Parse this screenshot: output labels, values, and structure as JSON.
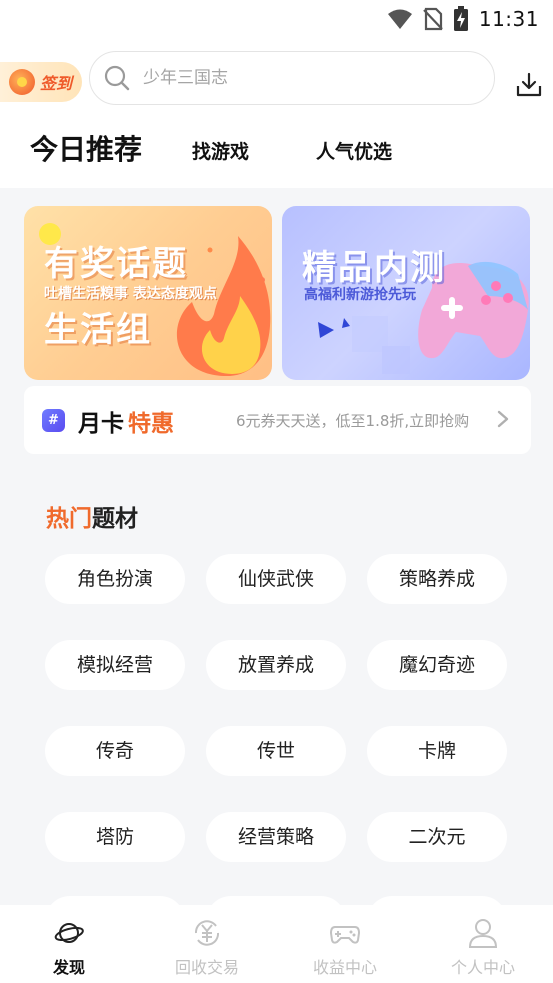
{
  "status_bar": {
    "time": "11:31"
  },
  "header": {
    "signin_label": "签到",
    "search_placeholder": "少年三国志",
    "tabs": [
      "今日推荐",
      "找游戏",
      "人气优选"
    ]
  },
  "banners": [
    {
      "title": "有奖话题",
      "subtitle": "吐槽生活糗事 表达态度观点",
      "title2": "生活组"
    },
    {
      "title": "精品内测",
      "subtitle": "高福利新游抢先玩"
    }
  ],
  "month_card": {
    "title_a": "月卡",
    "title_b": "特惠",
    "description": "6元券天天送，低至1.8折,立即抢购"
  },
  "hot_topics": {
    "title_a": "热门",
    "title_b": "题材",
    "chips": [
      "角色扮演",
      "仙侠武侠",
      "策略养成",
      "模拟经营",
      "放置养成",
      "魔幻奇迹",
      "传奇",
      "传世",
      "卡牌",
      "塔防",
      "经营策略",
      "二次元"
    ]
  },
  "bottom_nav": {
    "items": [
      {
        "label": "发现",
        "icon": "planet-icon"
      },
      {
        "label": "回收交易",
        "icon": "yuan-recycle-icon"
      },
      {
        "label": "收益中心",
        "icon": "gamepad-icon"
      },
      {
        "label": "个人中心",
        "icon": "person-icon"
      }
    ]
  },
  "colors": {
    "accent": "#f06a2c",
    "inactive": "#c2c2c2"
  }
}
